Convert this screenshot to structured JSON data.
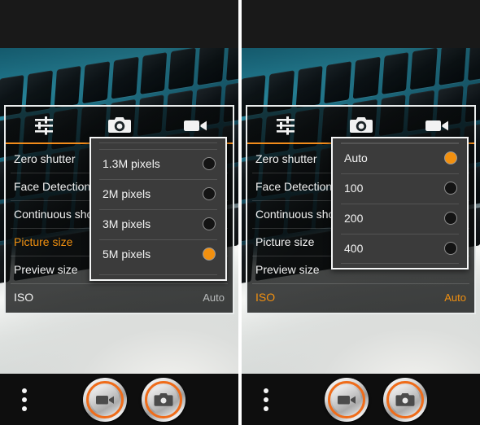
{
  "app": {
    "name": "Camera",
    "accent_color": "#f2900f",
    "shutter_ring_color": "#ef6c1a",
    "dialog_background": "#3b3b3b",
    "dialog_border": "#f4f5f5",
    "panel_text_color": "#f2f2f2"
  },
  "panels": [
    {
      "id": "picture-size-panel",
      "tabs": [
        {
          "icon": "sliders-icon",
          "name": "general-settings-tab",
          "active": true
        },
        {
          "icon": "camera-icon",
          "name": "photo-settings-tab",
          "active": false
        },
        {
          "icon": "video-camera-icon",
          "name": "video-settings-tab",
          "active": false
        }
      ],
      "settings_rows": [
        {
          "label": "Zero shutter",
          "value": "",
          "selected": false
        },
        {
          "label": "Face Detection",
          "value": "",
          "selected": false
        },
        {
          "label": "Continuous shot",
          "value": "",
          "selected": false
        },
        {
          "label": "Picture size",
          "value": "",
          "selected": true
        },
        {
          "label": "Preview size",
          "value": "",
          "selected": false
        },
        {
          "label": "ISO",
          "value": "Auto",
          "selected": false
        }
      ],
      "dialog": {
        "name": "picture-size-dialog",
        "options": [
          {
            "label": "1.3M pixels",
            "selected": false
          },
          {
            "label": "2M pixels",
            "selected": false
          },
          {
            "label": "3M pixels",
            "selected": false
          },
          {
            "label": "5M pixels",
            "selected": true
          }
        ]
      },
      "bottom_bar": {
        "overflow_menu": "more-options",
        "video_button": "record-video",
        "photo_button": "take-photo"
      }
    },
    {
      "id": "iso-panel",
      "tabs": [
        {
          "icon": "sliders-icon",
          "name": "general-settings-tab",
          "active": true
        },
        {
          "icon": "camera-icon",
          "name": "photo-settings-tab",
          "active": false
        },
        {
          "icon": "video-camera-icon",
          "name": "video-settings-tab",
          "active": false
        }
      ],
      "settings_rows": [
        {
          "label": "Zero shutter",
          "value": "",
          "selected": false
        },
        {
          "label": "Face Detection",
          "value": "",
          "selected": false
        },
        {
          "label": "Continuous shot",
          "value": "",
          "selected": false
        },
        {
          "label": "Picture size",
          "value": "",
          "selected": false
        },
        {
          "label": "Preview size",
          "value": "",
          "selected": false
        },
        {
          "label": "ISO",
          "value": "Auto",
          "selected": true
        }
      ],
      "dialog": {
        "name": "iso-dialog",
        "options": [
          {
            "label": "Auto",
            "selected": true
          },
          {
            "label": "100",
            "selected": false
          },
          {
            "label": "200",
            "selected": false
          },
          {
            "label": "400",
            "selected": false
          }
        ]
      },
      "bottom_bar": {
        "overflow_menu": "more-options",
        "video_button": "record-video",
        "photo_button": "take-photo"
      }
    }
  ]
}
